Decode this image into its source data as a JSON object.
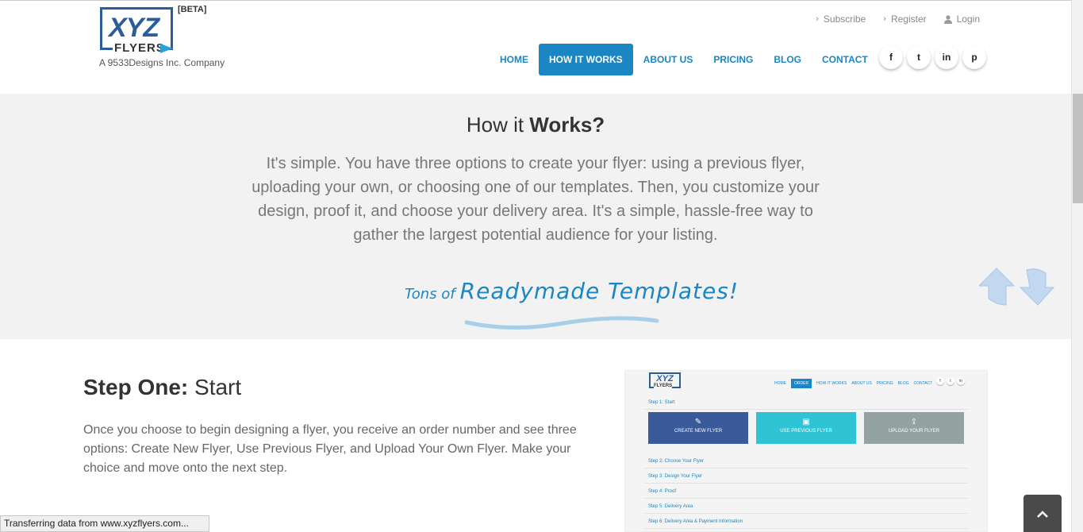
{
  "header": {
    "logo_text": "XYZ",
    "logo_sub": "FLYERS",
    "beta": "[BETA]",
    "tagline": "A 9533Designs Inc. Company",
    "top_links": [
      {
        "label": "Subscribe",
        "icon": "chevron-right-icon"
      },
      {
        "label": "Register",
        "icon": "chevron-right-icon"
      },
      {
        "label": "Login",
        "icon": "user-icon"
      }
    ],
    "nav": [
      {
        "label": "HOME",
        "active": false
      },
      {
        "label": "HOW IT WORKS",
        "active": true
      },
      {
        "label": "ABOUT US",
        "active": false
      },
      {
        "label": "PRICING",
        "active": false
      },
      {
        "label": "BLOG",
        "active": false
      },
      {
        "label": "CONTACT",
        "active": false
      }
    ],
    "social": [
      {
        "name": "facebook-icon",
        "glyph": "f"
      },
      {
        "name": "twitter-icon",
        "glyph": "t"
      },
      {
        "name": "linkedin-icon",
        "glyph": "in"
      },
      {
        "name": "pinterest-icon",
        "glyph": "p"
      }
    ]
  },
  "hero": {
    "title_light": "How it ",
    "title_bold": "Works?",
    "text": "It's simple. You have three options to create your flyer: using a previous flyer, uploading your own, or choosing one of our templates. Then, you customize your design, proof it, and choose your delivery area. It's a simple, hassle-free way to gather the largest potential audience for your listing.",
    "tagline_small": "Tons of",
    "tagline_big": "Readymade Templates!"
  },
  "step_one": {
    "title_bold": "Step One:",
    "title_light": " Start",
    "text": "Once you choose to begin designing a flyer, you receive an order number and see three options: Create New Flyer, Use Previous Flyer, and Upload Your Own Flyer. Make your choice and move onto the next step."
  },
  "preview": {
    "logo": "XYZ",
    "logo_sub": "FLYERS",
    "nav": [
      "HOME",
      "ORDER",
      "HOW IT WORKS",
      "ABOUT US",
      "PRICING",
      "BLOG",
      "CONTACT"
    ],
    "step1": "Step 1: Start",
    "buttons": [
      {
        "label": "CREATE NEW FLYER",
        "color": "#3a5a9a"
      },
      {
        "label": "USE PREVIOUS FLYER",
        "color": "#2ec4d6"
      },
      {
        "label": "UPLOAD YOUR FLYER",
        "color": "#95a2a2"
      }
    ],
    "steps": [
      "Step 2: Choose Your Flyer",
      "Step 3: Design Your Flyer",
      "Step 4: Proof",
      "Step 5: Delivery Area",
      "Step 6: Delivery Area & Payment Information"
    ]
  },
  "status_bar": "Transferring data from www.xyzflyers.com...",
  "colors": {
    "accent": "#1a86c4",
    "logo": "#2a5d9a",
    "hero_bg": "#f2f2f2"
  }
}
